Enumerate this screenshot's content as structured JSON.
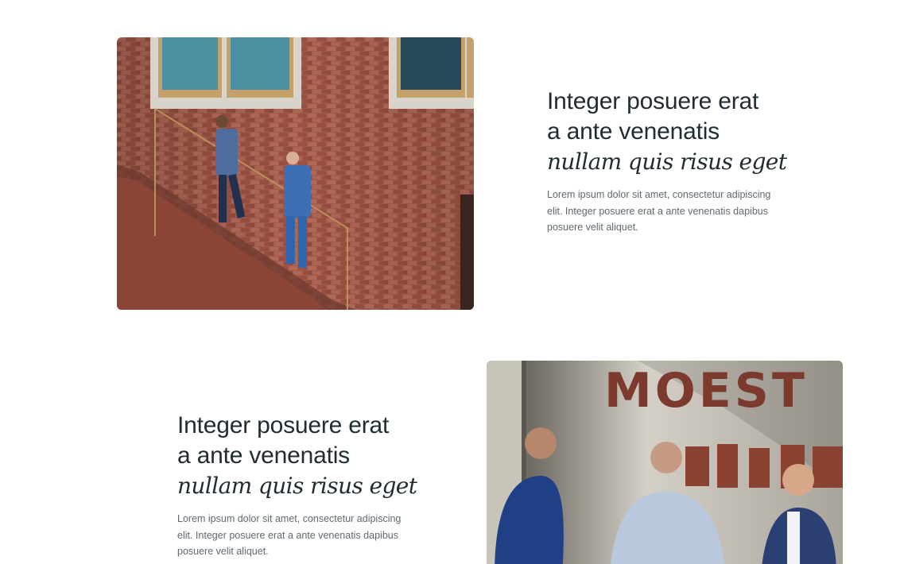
{
  "sections": [
    {
      "photo": {
        "description_icon": "photo-image"
      },
      "heading": {
        "line1": "Integer posuere erat",
        "line2": "a ante venenatis",
        "line3_italic": "nullam quis risus eget"
      },
      "body": "Lorem ipsum dolor sit amet, consectetur adipiscing elit. Integer posuere erat a ante venenatis dapibus posuere velit aliquet."
    },
    {
      "photo": {
        "description_icon": "photo-image",
        "wall_sign_text": "MOEST"
      },
      "heading": {
        "line1": "Integer posuere erat",
        "line2": "a ante venenatis",
        "line3_italic": "nullam quis risus eget"
      },
      "body": "Lorem ipsum dolor sit amet, consectetur adipiscing elit. Integer posuere erat a ante venenatis dapibus posuere velit aliquet."
    }
  ],
  "colors": {
    "heading": "#1f2d33",
    "body": "#5e6a70",
    "background": "#ffffff",
    "brick": "#a5584a"
  }
}
